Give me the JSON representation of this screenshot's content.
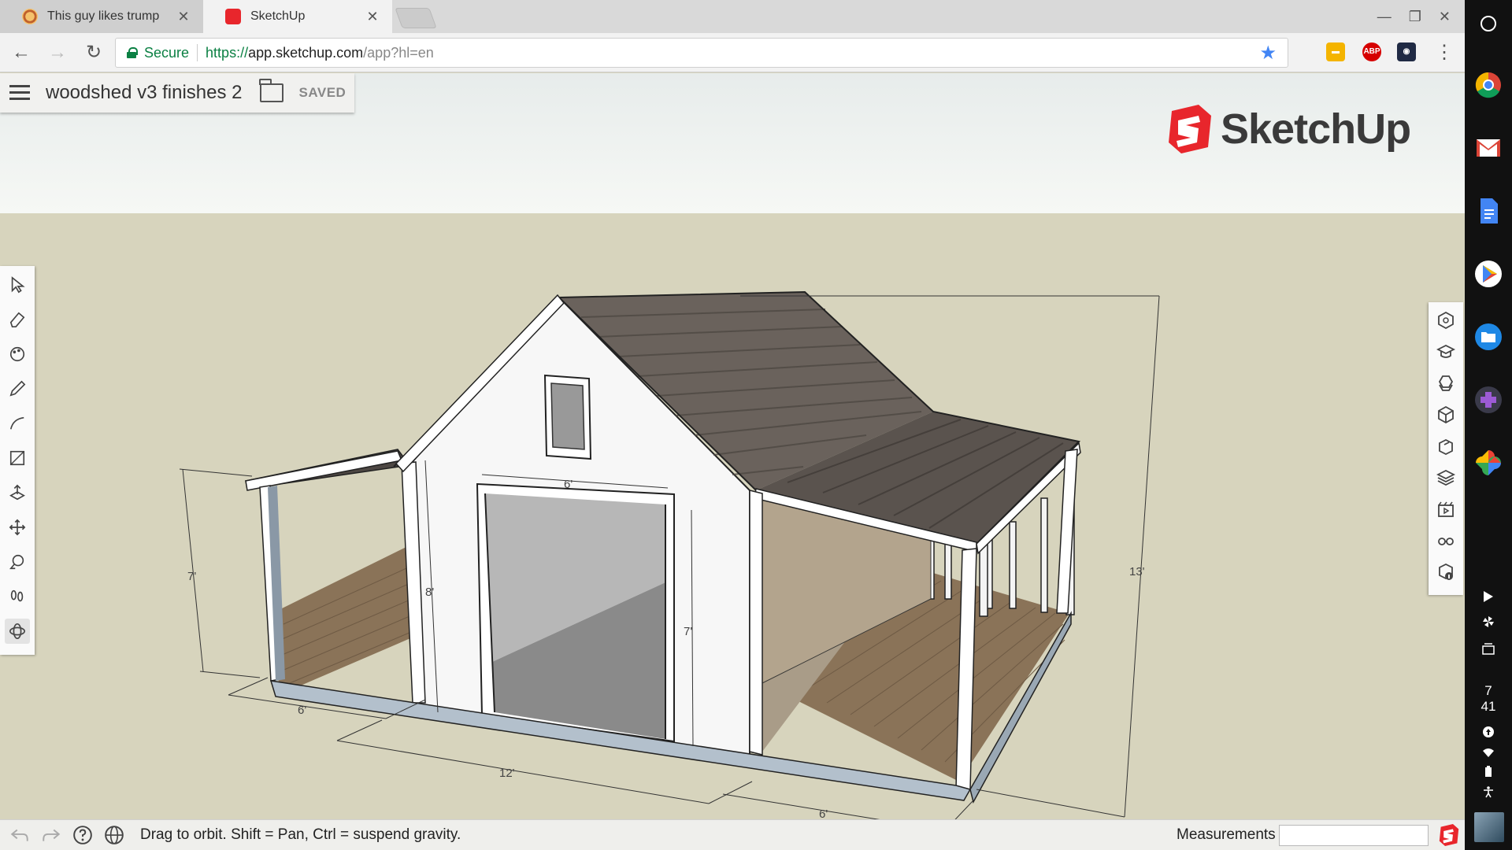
{
  "browser": {
    "tabs": [
      {
        "title": "This guy likes trump",
        "active": false,
        "icon": "pizza-favicon"
      },
      {
        "title": "SketchUp",
        "active": true,
        "icon": "sketchup-favicon"
      }
    ],
    "omnibox": {
      "secure_label": "Secure",
      "url_scheme": "https://",
      "url_host": "app.sketchup.com",
      "url_path": "/app?hl=en"
    },
    "extensions": [
      {
        "name": "keep-extension-icon",
        "color": "#f4b400"
      },
      {
        "name": "adblock-plus-icon",
        "label": "ABP",
        "color": "#d60000"
      },
      {
        "name": "screen-capture-extension-icon",
        "color": "#202a44"
      }
    ]
  },
  "app": {
    "doc_title": "woodshed v3 finishes 2",
    "save_status": "SAVED",
    "logo_text": "SketchUp",
    "accent": "#e8262c",
    "left_tools": [
      "select-tool-icon",
      "eraser-tool-icon",
      "paint-bucket-tool-icon",
      "pencil-tool-icon",
      "arc-tool-icon",
      "rectangle-tool-icon",
      "push-pull-tool-icon",
      "move-tool-icon",
      "tape-measure-tool-icon",
      "walk-tool-icon",
      "orbit-tool-icon"
    ],
    "selected_tool": "orbit-tool-icon",
    "right_tools": [
      "components-icon",
      "instructor-icon",
      "materials-icon",
      "entity-info-icon",
      "outliner-icon",
      "layers-icon",
      "scenes-icon",
      "display-styles-icon",
      "model-info-icon"
    ],
    "dimensions": {
      "left_porch_height": "7'",
      "door_width": "6'",
      "wall_height": "8'",
      "door_height": "7'",
      "overall_height": "13'",
      "left_porch_depth": "6'",
      "shed_length": "12'",
      "right_porch_depth": "6'"
    },
    "status": {
      "hint": "Drag to orbit. Shift = Pan, Ctrl = suspend gravity.",
      "measurements_label": "Measurements",
      "measurements_value": ""
    }
  },
  "shelf": {
    "apps": [
      "chrome-icon",
      "gmail-icon",
      "docs-icon",
      "play-store-icon",
      "files-icon",
      "game-controller-icon",
      "photos-icon"
    ],
    "clock_hour": "7",
    "clock_minute": "41",
    "tray": [
      "play-icon",
      "pinwheel-icon",
      "gallery-icon",
      "cast-icon",
      "wifi-icon",
      "battery-icon",
      "accessibility-icon"
    ]
  }
}
